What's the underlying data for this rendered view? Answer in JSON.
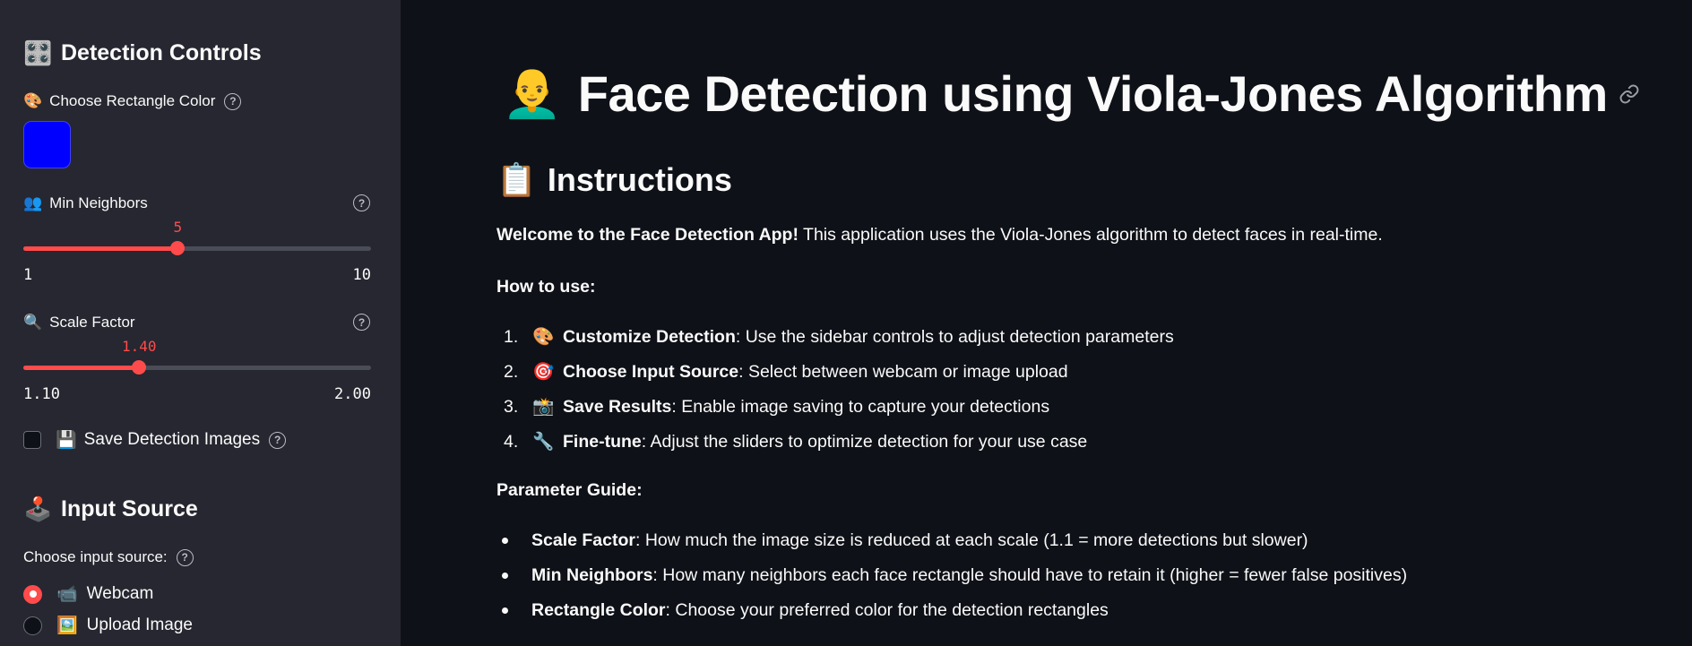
{
  "sidebar": {
    "detection_controls": {
      "icon": "dice-icon",
      "emoji": "🎛️",
      "title": "Detection Controls"
    },
    "rect_color": {
      "emoji": "🎨",
      "label": "Choose Rectangle Color",
      "value": "#0000ff"
    },
    "min_neighbors": {
      "emoji": "👥",
      "label": "Min Neighbors",
      "value": "5",
      "min": "1",
      "max": "10",
      "fraction": 0.444
    },
    "scale_factor": {
      "emoji": "🔍",
      "label": "Scale Factor",
      "value": "1.40",
      "min": "1.10",
      "max": "2.00",
      "fraction": 0.333
    },
    "save_images": {
      "emoji": "💾",
      "label": "Save Detection Images",
      "checked": false
    },
    "input_source": {
      "emoji": "🕹️",
      "title": "Input Source"
    },
    "input_choice": {
      "label": "Choose input source:",
      "options": [
        {
          "emoji": "📹",
          "label": "Webcam",
          "selected": true
        },
        {
          "emoji": "🖼️",
          "label": "Upload Image",
          "selected": false
        }
      ]
    }
  },
  "main": {
    "title_emoji": "👨‍🦲",
    "title": "Face Detection using Viola-Jones Algorithm",
    "instructions": {
      "emoji": "📋",
      "title": "Instructions"
    },
    "welcome_bold": "Welcome to the Face Detection App!",
    "welcome_text": " This application uses the Viola-Jones algorithm to detect faces in real-time.",
    "how_to_use": "How to use:",
    "steps": [
      {
        "num": "1.",
        "emoji": "🎨",
        "bold": "Customize Detection",
        "text": ": Use the sidebar controls to adjust detection parameters"
      },
      {
        "num": "2.",
        "emoji": "🎯",
        "bold": "Choose Input Source",
        "text": ": Select between webcam or image upload"
      },
      {
        "num": "3.",
        "emoji": "📸",
        "bold": "Save Results",
        "text": ": Enable image saving to capture your detections"
      },
      {
        "num": "4.",
        "emoji": "🔧",
        "bold": "Fine-tune",
        "text": ": Adjust the sliders to optimize detection for your use case"
      }
    ],
    "parameter_guide": "Parameter Guide:",
    "params": [
      {
        "bold": "Scale Factor",
        "text": ": How much the image size is reduced at each scale (1.1 = more detections but slower)"
      },
      {
        "bold": "Min Neighbors",
        "text": ": How many neighbors each face rectangle should have to retain it (higher = fewer false positives)"
      },
      {
        "bold": "Rectangle Color",
        "text": ": Choose your preferred color for the detection rectangles"
      }
    ]
  }
}
